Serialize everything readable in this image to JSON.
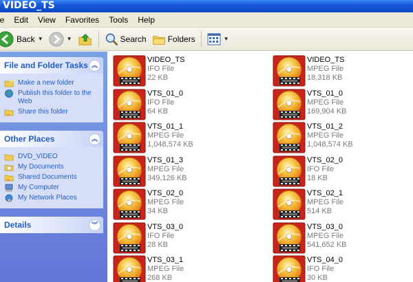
{
  "window": {
    "title": "VIDEO_TS"
  },
  "menu": {
    "items": [
      "le",
      "Edit",
      "View",
      "Favorites",
      "Tools",
      "Help"
    ]
  },
  "toolbar": {
    "back_label": "Back",
    "search_label": "Search",
    "folders_label": "Folders"
  },
  "left_pane": {
    "file_tasks": {
      "title": "File and Folder Tasks",
      "items": [
        "Make a new folder",
        "Publish this folder to the Web",
        "Share this folder"
      ]
    },
    "other_places": {
      "title": "Other Places",
      "items": [
        "DVD_VIDEO",
        "My Documents",
        "Shared Documents",
        "My Computer",
        "My Network Places"
      ]
    },
    "details": {
      "title": "Details"
    }
  },
  "files": [
    {
      "name": "VIDEO_TS",
      "type": "IFO File",
      "size": "22 KB"
    },
    {
      "name": "VIDEO_TS",
      "type": "MPEG File",
      "size": "18,318 KB"
    },
    {
      "name": "VTS_01_0",
      "type": "IFO File",
      "size": "64 KB"
    },
    {
      "name": "VTS_01_0",
      "type": "MPEG File",
      "size": "169,904 KB"
    },
    {
      "name": "VTS_01_1",
      "type": "MPEG File",
      "size": "1,048,574 KB"
    },
    {
      "name": "VTS_01_2",
      "type": "MPEG File",
      "size": "1,048,574 KB"
    },
    {
      "name": "VTS_01_3",
      "type": "MPEG File",
      "size": "349,126 KB"
    },
    {
      "name": "VTS_02_0",
      "type": "IFO File",
      "size": "18 KB"
    },
    {
      "name": "VTS_02_0",
      "type": "MPEG File",
      "size": "34 KB"
    },
    {
      "name": "VTS_02_1",
      "type": "MPEG File",
      "size": "514 KB"
    },
    {
      "name": "VTS_03_0",
      "type": "IFO File",
      "size": "28 KB"
    },
    {
      "name": "VTS_03_0",
      "type": "MPEG File",
      "size": "541,652 KB"
    },
    {
      "name": "VTS_03_1",
      "type": "MPEG File",
      "size": "268 KB"
    },
    {
      "name": "VTS_04_0",
      "type": "IFO File",
      "size": "30 KB"
    }
  ]
}
